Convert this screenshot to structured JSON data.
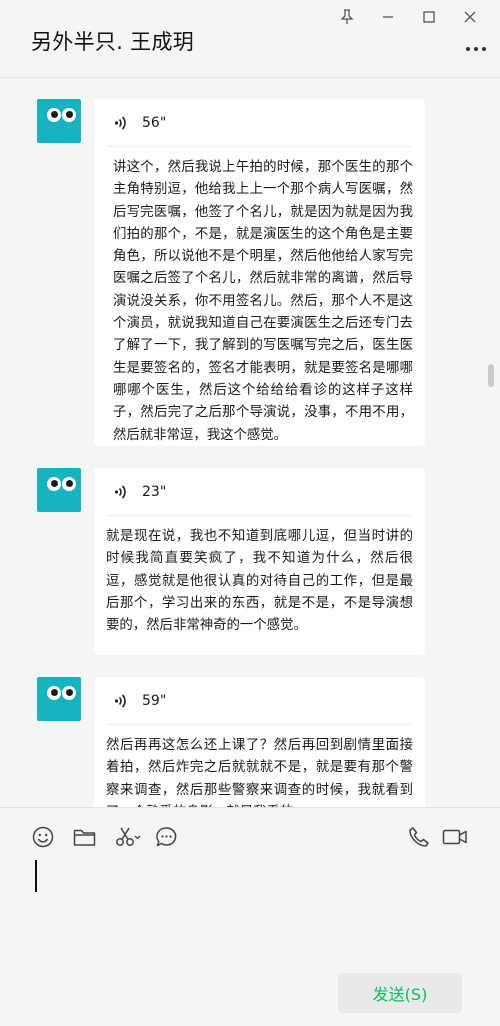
{
  "header": {
    "title": "另外半只. 王成玥",
    "window_controls": [
      "pin-icon",
      "minimize-icon",
      "maximize-icon",
      "close-icon"
    ],
    "more_icon": "more-icon"
  },
  "messages": [
    {
      "type": "voice",
      "duration": "56\"",
      "transcript": "讲这个，然后我说上午拍的时候，那个医生的那个主角特别逗，他给我上上一个那个病人写医嘱，然后写完医嘱，他签了个名儿，就是因为就是因为我们拍的那个，不是，就是演医生的这个角色是主要角色，所以说他不是个明星，然后他他给人家写完医嘱之后签了个名儿，然后就非常的离谱，然后导演说没关系，你不用签名儿。然后，那个人不是这个演员，就说我知道自己在要演医生之后还专门去了解了一下，我了解到的写医嘱写完之后，医生医生是要签名的，签名才能表明，就是要签名是哪哪哪哪个医生，然后这个给给给看诊的这样子这样子，然后完了之后那个导演说，没事，不用不用，然后就非常逗，我这个感觉。"
    },
    {
      "type": "voice",
      "duration": "23\"",
      "transcript": "就是现在说，我也不知道到底哪儿逗，但当时讲的时候我简直要笑疯了，我不知道为什么，然后很逗，感觉就是他很认真的对待自己的工作，但是最后那个，学习出来的东西，就是不是，不是导演想要的，然后非常神奇的一个感觉。"
    },
    {
      "type": "voice",
      "duration": "59\"",
      "transcript": "然后再再这怎么还上课了？然后再回到剧情里面接着拍，然后炸完之后就就就不是，就是要有那个警察来调查，然后那些警察来调查的时候，我就看到了一个熟悉的身影，就是我看的"
    }
  ],
  "composer": {
    "tools": [
      "emoji-icon",
      "folder-icon",
      "scissors-icon",
      "chat-history-icon"
    ],
    "call_tools": [
      "phone-icon",
      "video-icon"
    ],
    "send_label": "发送(S)"
  },
  "colors": {
    "avatar": "#17b3c1",
    "send_text": "#07c160",
    "background": "#f5f5f5",
    "bubble": "#ffffff"
  }
}
